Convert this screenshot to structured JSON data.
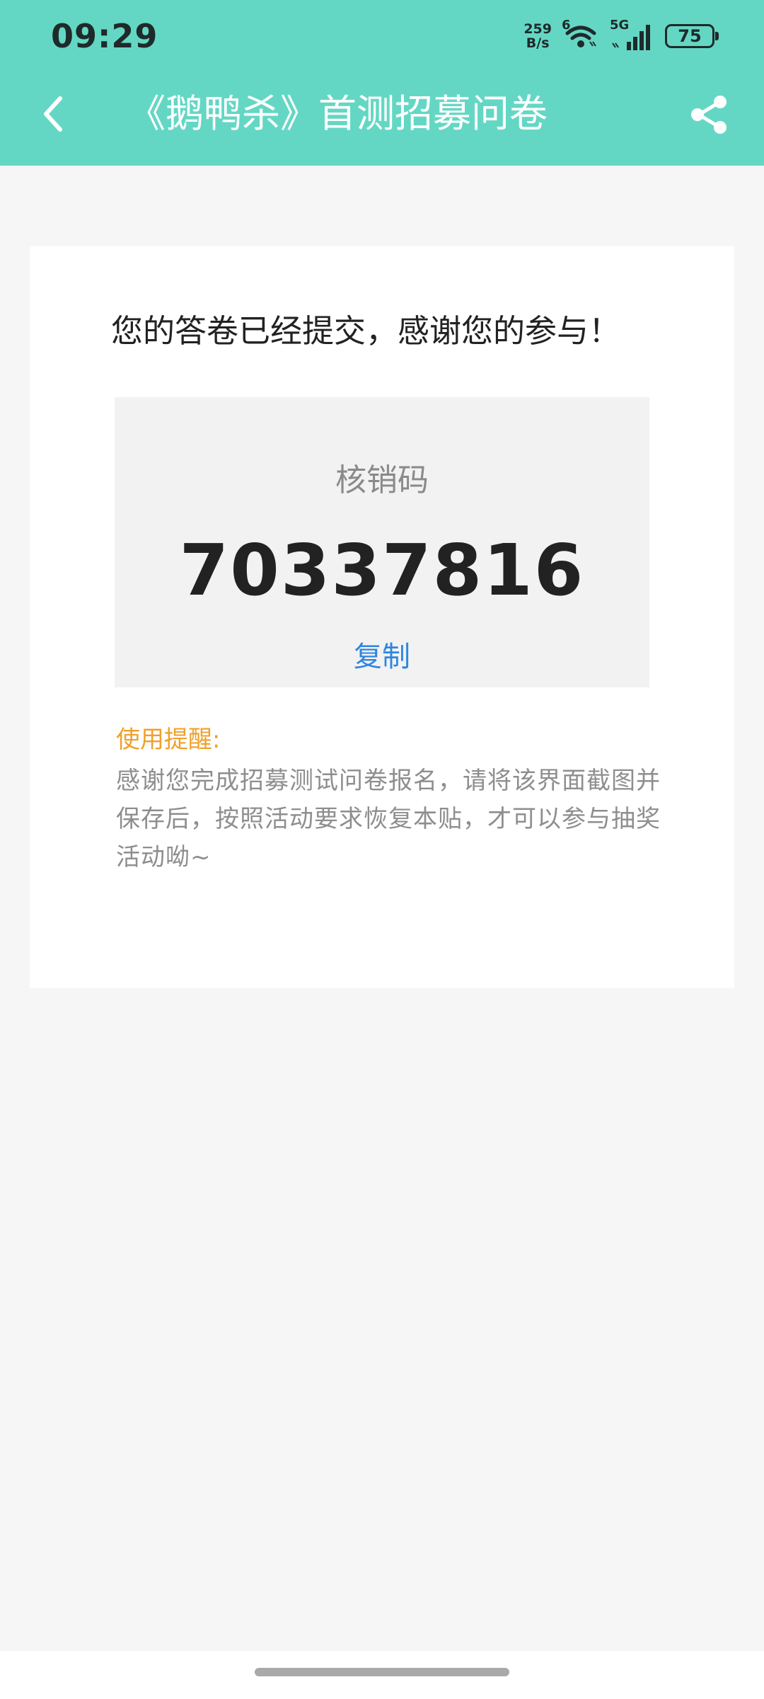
{
  "status_bar": {
    "time": "09:29",
    "net_speed_value": "259",
    "net_speed_unit": "B/s",
    "wifi_label": "6",
    "cell_label": "5G",
    "battery": "75"
  },
  "nav": {
    "title": "《鹅鸭杀》首测招募问卷",
    "back_icon": "chevron-left-icon",
    "share_icon": "share-icon"
  },
  "card": {
    "thanks_text": "您的答卷已经提交，感谢您的参与！",
    "code_label": "核销码",
    "code_value": "70337816",
    "copy_label": "复制",
    "notice_title": "使用提醒:",
    "notice_body": "感谢您完成招募测试问卷报名，请将该界面截图并保存后，按照活动要求恢复本贴，才可以参与抽奖活动呦~"
  },
  "colors": {
    "header_bg": "#64d7c4",
    "page_bg": "#f6f6f6",
    "code_box_bg": "#f2f2f2",
    "link": "#2f86dd",
    "notice_title": "#f0a02a",
    "notice_body": "#8e8e8e"
  }
}
